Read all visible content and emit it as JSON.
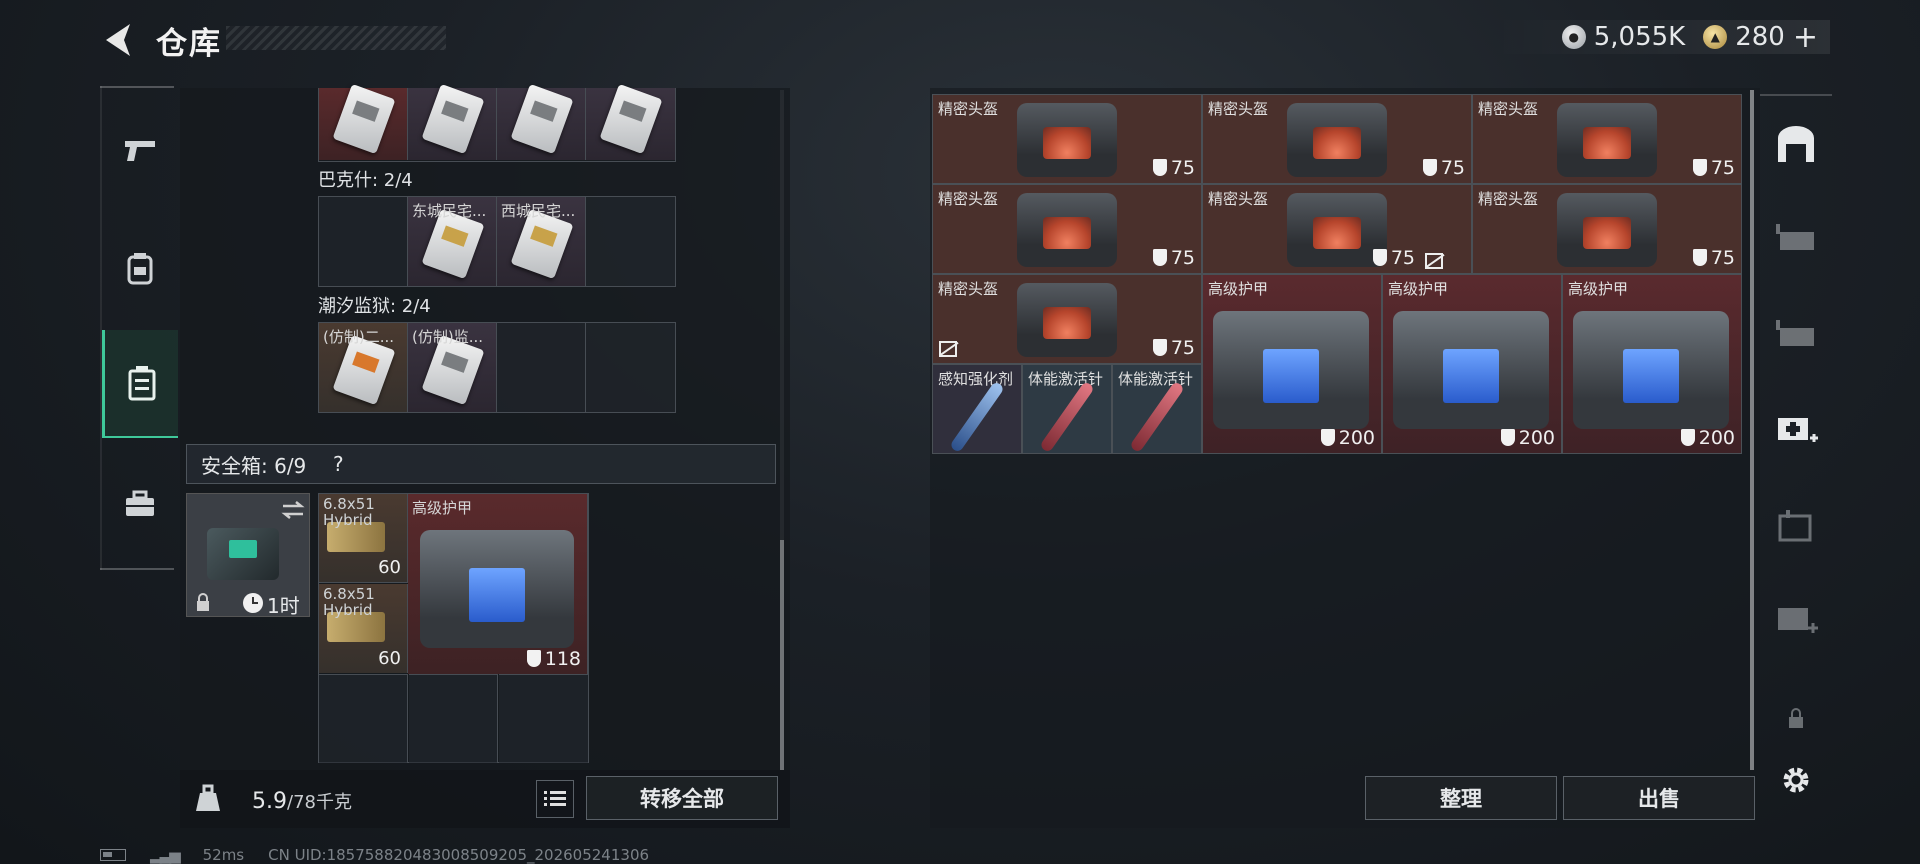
{
  "header": {
    "title": "仓库",
    "currency": [
      {
        "icon": "silver-coin-icon",
        "value": "5,055K"
      },
      {
        "icon": "gold-coin-icon",
        "value": "280"
      }
    ],
    "add_label": "+"
  },
  "left_nav": [
    "weapon-nav-icon",
    "backpack-nav-icon",
    "storage-nav-icon",
    "toolbox-nav-icon"
  ],
  "left_panel": {
    "keycard_groups": [
      {
        "label": "巴克什: 2/4",
        "slots": [
          "东城民宅...",
          "西城民宅..."
        ]
      },
      {
        "label": "潮汐监狱: 2/4",
        "slots": [
          "(仿制)二...",
          "(仿制)监..."
        ]
      }
    ],
    "safebox": {
      "label": "安全箱: 6/9",
      "help": "?",
      "timer": "1时",
      "ammo": [
        {
          "name": "6.8x51 Hybrid",
          "qty": "60"
        },
        {
          "name": "6.8x51 Hybrid",
          "qty": "60"
        }
      ],
      "armor": {
        "name": "高级护甲",
        "durability": "118"
      }
    },
    "weight": {
      "current": "5.9",
      "max": "/78千克"
    },
    "transfer_all": "转移全部"
  },
  "right_panel": {
    "helmets": [
      {
        "name": "精密头盔",
        "durability": "75"
      },
      {
        "name": "精密头盔",
        "durability": "75"
      },
      {
        "name": "精密头盔",
        "durability": "75"
      },
      {
        "name": "精密头盔",
        "durability": "75"
      },
      {
        "name": "精密头盔",
        "durability": "75"
      },
      {
        "name": "精密头盔",
        "durability": "75"
      },
      {
        "name": "精密头盔",
        "durability": "75"
      }
    ],
    "armors": [
      {
        "name": "高级护甲",
        "durability": "200"
      },
      {
        "name": "高级护甲",
        "durability": "200"
      },
      {
        "name": "高级护甲",
        "durability": "200"
      }
    ],
    "consumables": [
      {
        "name": "感知强化剂",
        "color": "#3f7fd0"
      },
      {
        "name": "体能激活针",
        "color": "#c0464f"
      },
      {
        "name": "体能激活针",
        "color": "#c0464f"
      }
    ],
    "tidy": "整理",
    "sell": "出售"
  },
  "status": {
    "ping": "52ms",
    "uid": "CN UID:185758820483008509205_202605241306"
  }
}
